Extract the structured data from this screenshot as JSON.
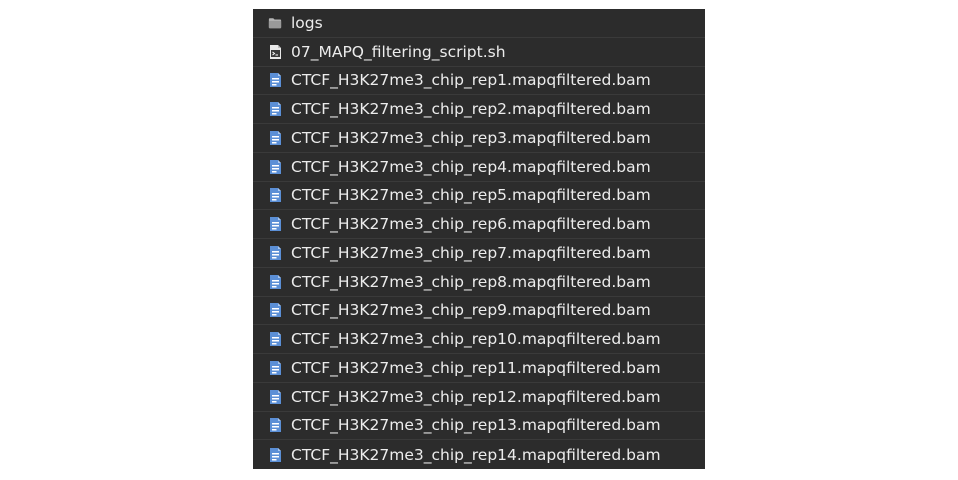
{
  "file_list": {
    "items": [
      {
        "name": "logs",
        "type": "folder",
        "icon": "folder-icon"
      },
      {
        "name": "07_MAPQ_filtering_script.sh",
        "type": "script",
        "icon": "shell-script-icon"
      },
      {
        "name": "CTCF_H3K27me3_chip_rep1.mapqfiltered.bam",
        "type": "bam",
        "icon": "binary-file-icon"
      },
      {
        "name": "CTCF_H3K27me3_chip_rep2.mapqfiltered.bam",
        "type": "bam",
        "icon": "binary-file-icon"
      },
      {
        "name": "CTCF_H3K27me3_chip_rep3.mapqfiltered.bam",
        "type": "bam",
        "icon": "binary-file-icon"
      },
      {
        "name": "CTCF_H3K27me3_chip_rep4.mapqfiltered.bam",
        "type": "bam",
        "icon": "binary-file-icon"
      },
      {
        "name": "CTCF_H3K27me3_chip_rep5.mapqfiltered.bam",
        "type": "bam",
        "icon": "binary-file-icon"
      },
      {
        "name": "CTCF_H3K27me3_chip_rep6.mapqfiltered.bam",
        "type": "bam",
        "icon": "binary-file-icon"
      },
      {
        "name": "CTCF_H3K27me3_chip_rep7.mapqfiltered.bam",
        "type": "bam",
        "icon": "binary-file-icon"
      },
      {
        "name": "CTCF_H3K27me3_chip_rep8.mapqfiltered.bam",
        "type": "bam",
        "icon": "binary-file-icon"
      },
      {
        "name": "CTCF_H3K27me3_chip_rep9.mapqfiltered.bam",
        "type": "bam",
        "icon": "binary-file-icon"
      },
      {
        "name": "CTCF_H3K27me3_chip_rep10.mapqfiltered.bam",
        "type": "bam",
        "icon": "binary-file-icon"
      },
      {
        "name": "CTCF_H3K27me3_chip_rep11.mapqfiltered.bam",
        "type": "bam",
        "icon": "binary-file-icon"
      },
      {
        "name": "CTCF_H3K27me3_chip_rep12.mapqfiltered.bam",
        "type": "bam",
        "icon": "binary-file-icon"
      },
      {
        "name": "CTCF_H3K27me3_chip_rep13.mapqfiltered.bam",
        "type": "bam",
        "icon": "binary-file-icon"
      },
      {
        "name": "CTCF_H3K27me3_chip_rep14.mapqfiltered.bam",
        "type": "bam",
        "icon": "binary-file-icon"
      }
    ]
  },
  "colors": {
    "panel_background": "#2c2c2c",
    "text": "#ececec",
    "folder_icon": "#b0b0b0",
    "binary_icon": "#5b8fd6"
  }
}
